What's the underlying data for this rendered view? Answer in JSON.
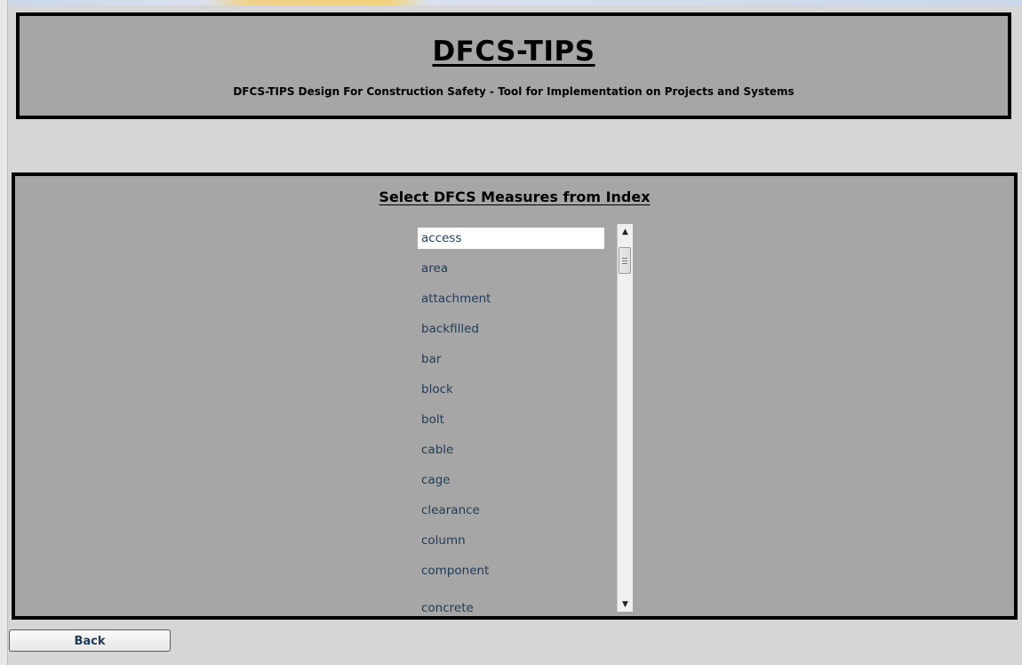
{
  "header": {
    "title": "DFCS-TIPS",
    "subtitle": "DFCS-TIPS Design For Construction Safety - Tool for Implementation on Projects and Systems"
  },
  "main": {
    "section_title": "Select DFCS Measures from Index",
    "index_list": {
      "selected": "access",
      "items": [
        "access",
        "area",
        "attachment",
        "backfilled",
        "bar",
        "block",
        "bolt",
        "cable",
        "cage",
        "clearance",
        "column",
        "component",
        "concrete"
      ]
    }
  },
  "footer": {
    "back_label": "Back"
  },
  "icons": {
    "scroll_up": "up-arrow-icon",
    "scroll_down": "down-arrow-icon"
  }
}
